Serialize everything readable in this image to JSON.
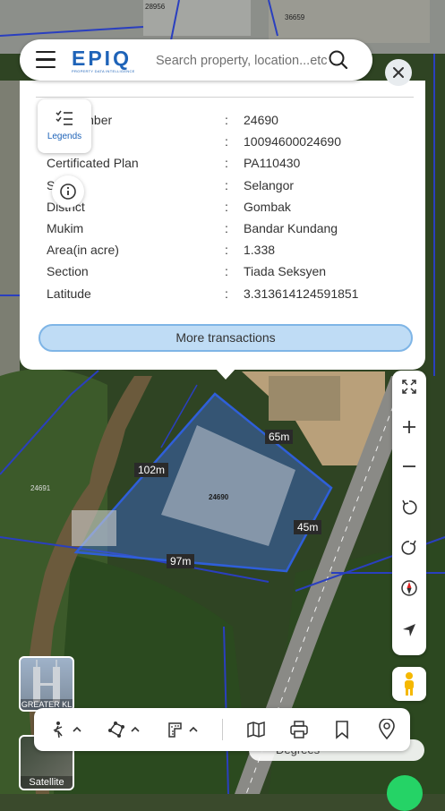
{
  "header": {
    "logo_text": "EPIQ",
    "logo_tagline": "PROPERTY DATA INTELLIGENCE",
    "search_placeholder": "Search property, location...etc"
  },
  "panel": {
    "rows": [
      {
        "label": "Lot Number",
        "value": "24690"
      },
      {
        "label": "",
        "value": "10094600024690"
      },
      {
        "label": "Certificated Plan",
        "value": "PA110430"
      },
      {
        "label": "S",
        "value": "Selangor"
      },
      {
        "label": "District",
        "value": "Gombak"
      },
      {
        "label": "Mukim",
        "value": "Bandar Kundang"
      },
      {
        "label": "Area(in acre)",
        "value": "1.338"
      },
      {
        "label": "Section",
        "value": "Tiada Seksyen"
      },
      {
        "label": "Latitude",
        "value": "3.313614124591851"
      }
    ],
    "separator": ":",
    "more_button": "More transactions"
  },
  "legends": {
    "label": "Legends"
  },
  "map": {
    "lot_id": "24690",
    "nearby_lots": [
      "24691",
      "36659",
      "28956"
    ],
    "dimensions": {
      "top": "65m",
      "left": "102m",
      "right": "45m",
      "bottom": "97m"
    },
    "highlight_color": "#3d6bd6"
  },
  "thumbnails": {
    "region": "GREATER KL",
    "basemap": "Satellite"
  },
  "degrees_label": "Degrees",
  "icons": {
    "menu": "hamburger-icon",
    "search": "search-icon",
    "close": "close-icon",
    "legends": "list-icon",
    "info": "info-icon",
    "fullscreen": "expand-icon",
    "zoom_in": "plus-icon",
    "zoom_out": "minus-icon",
    "rotate_left": "rotate-ccw-icon",
    "rotate_right": "rotate-cw-icon",
    "compass": "compass-icon",
    "locate": "navigation-arrow-icon",
    "street_view": "pegman-icon",
    "tool_measure": "ruler-person-icon",
    "tool_polygon": "polygon-icon",
    "tool_area": "area-ruler-icon",
    "map": "map-icon",
    "print": "printer-icon",
    "bookmark": "bookmark-icon",
    "pin": "location-pin-icon"
  }
}
